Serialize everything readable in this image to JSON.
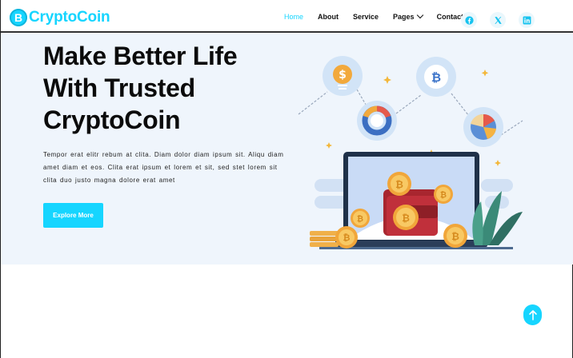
{
  "brand": {
    "icon_letter": "B",
    "name": "CryptoCoin",
    "color": "#16d5ff"
  },
  "nav": {
    "items": [
      {
        "label": "Home",
        "active": true
      },
      {
        "label": "About"
      },
      {
        "label": "Service"
      },
      {
        "label": "Pages"
      },
      {
        "label": "Contact"
      }
    ],
    "socials": [
      "facebook-icon",
      "x-twitter-icon",
      "linkedin-icon"
    ]
  },
  "hero": {
    "headline_lines": [
      "Make Better Life",
      "With Trusted",
      "CryptoCoin"
    ],
    "paragraph": "Tempor erat elitr rebum at clita. Diam dolor diam ipsum sit. Aliqu diam amet diam et eos. Clita erat ipsum et lorem et sit, sed stet lorem sit clita duo justo magna dolore erat amet",
    "cta_label": "Explore More",
    "background": "#eff5fc"
  },
  "back_to_top": {
    "icon": "arrow-up-icon"
  }
}
